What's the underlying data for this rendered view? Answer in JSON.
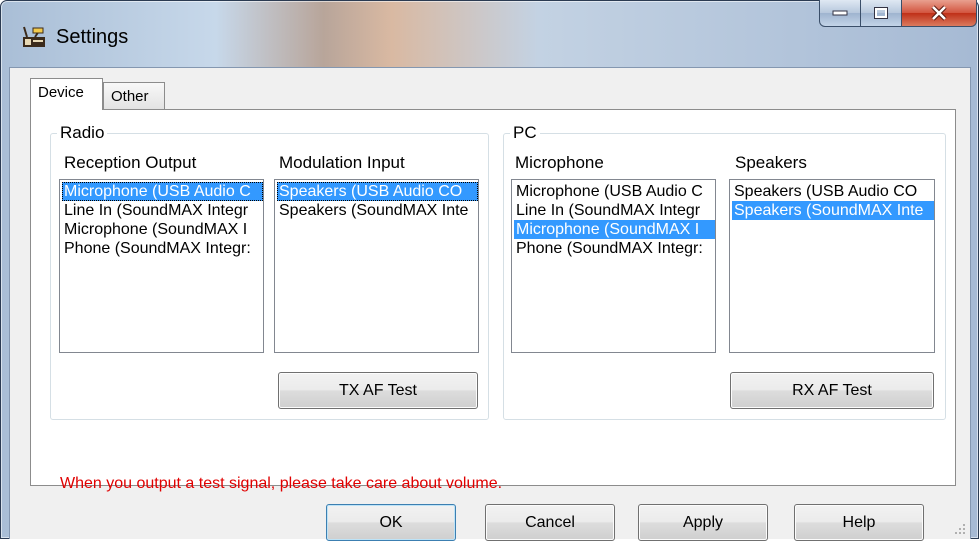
{
  "window": {
    "title": "Settings",
    "controls": {
      "minimize": "minimize",
      "maximize": "maximize",
      "close": "close"
    }
  },
  "tabs": [
    {
      "label": "Device",
      "active": true
    },
    {
      "label": "Other",
      "active": false
    }
  ],
  "radio": {
    "group_label": "Radio",
    "reception_output": {
      "label": "Reception Output",
      "items": [
        "Microphone (USB Audio C",
        "Line In (SoundMAX Integr",
        "Microphone (SoundMAX I",
        "Phone (SoundMAX Integr:"
      ],
      "selected_index": 0
    },
    "modulation_input": {
      "label": "Modulation Input",
      "items": [
        "Speakers (USB Audio CO",
        "Speakers (SoundMAX Inte"
      ],
      "selected_index": 0
    },
    "tx_button": "TX AF Test"
  },
  "pc": {
    "group_label": "PC",
    "microphone": {
      "label": "Microphone",
      "items": [
        "Microphone (USB Audio C",
        "Line In (SoundMAX Integr",
        "Microphone (SoundMAX I",
        "Phone (SoundMAX Integr:"
      ],
      "selected_index": 2
    },
    "speakers": {
      "label": "Speakers",
      "items": [
        "Speakers (USB Audio CO",
        "Speakers (SoundMAX Inte"
      ],
      "selected_index": 1
    },
    "rx_button": "RX AF Test"
  },
  "warning_text": "When you output a test signal, please take care about volume.",
  "footer": {
    "ok": "OK",
    "cancel": "Cancel",
    "apply": "Apply",
    "help": "Help"
  },
  "colors": {
    "selection": "#3399ff",
    "warning": "#e00000"
  }
}
